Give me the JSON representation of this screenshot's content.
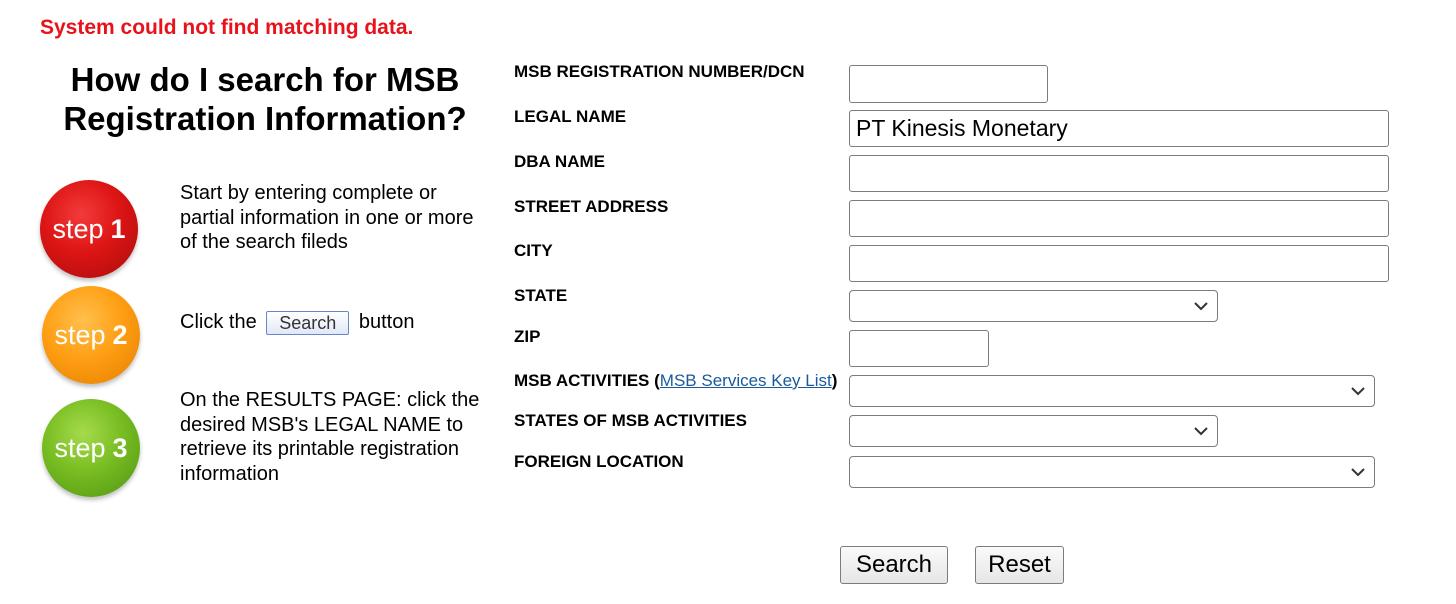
{
  "error": {
    "message": "System could not find matching data."
  },
  "help": {
    "title": "How do I search for MSB Registration Information?",
    "steps": [
      {
        "word": "step",
        "number": "1",
        "text": "Start by entering complete or partial information in one or more of the search fileds"
      },
      {
        "word": "step",
        "number": "2",
        "text_before": "Click the",
        "inline_button": "Search",
        "text_after": "button"
      },
      {
        "word": "step",
        "number": "3",
        "text": "On the RESULTS PAGE: click the desired MSB's LEGAL NAME to retrieve its printable registration information"
      }
    ]
  },
  "form": {
    "fields": {
      "registration_number": {
        "label": "MSB REGISTRATION NUMBER/DCN",
        "value": ""
      },
      "legal_name": {
        "label": "LEGAL NAME",
        "value": "PT Kinesis Monetary"
      },
      "dba_name": {
        "label": "DBA NAME",
        "value": ""
      },
      "street_address": {
        "label": "STREET ADDRESS",
        "value": ""
      },
      "city": {
        "label": "CITY",
        "value": ""
      },
      "state": {
        "label": "STATE",
        "selected": ""
      },
      "zip": {
        "label": "ZIP",
        "value": ""
      },
      "msb_activities": {
        "label": "MSB ACTIVITIES",
        "link_open": "(",
        "link_text": "MSB Services Key List",
        "link_close": ")",
        "selected": ""
      },
      "states_of_msb_activities": {
        "label": "STATES OF MSB ACTIVITIES",
        "selected": ""
      },
      "foreign_location": {
        "label": "FOREIGN LOCATION",
        "selected": ""
      }
    },
    "buttons": {
      "search": "Search",
      "reset": "Reset"
    }
  },
  "colors": {
    "error": "#e8121b",
    "link": "#1a5a9c",
    "step1": "#dd1414",
    "step2": "#ff9f14",
    "step3": "#78bd22"
  },
  "icons": {
    "dropdown": "chevron-down-icon"
  }
}
